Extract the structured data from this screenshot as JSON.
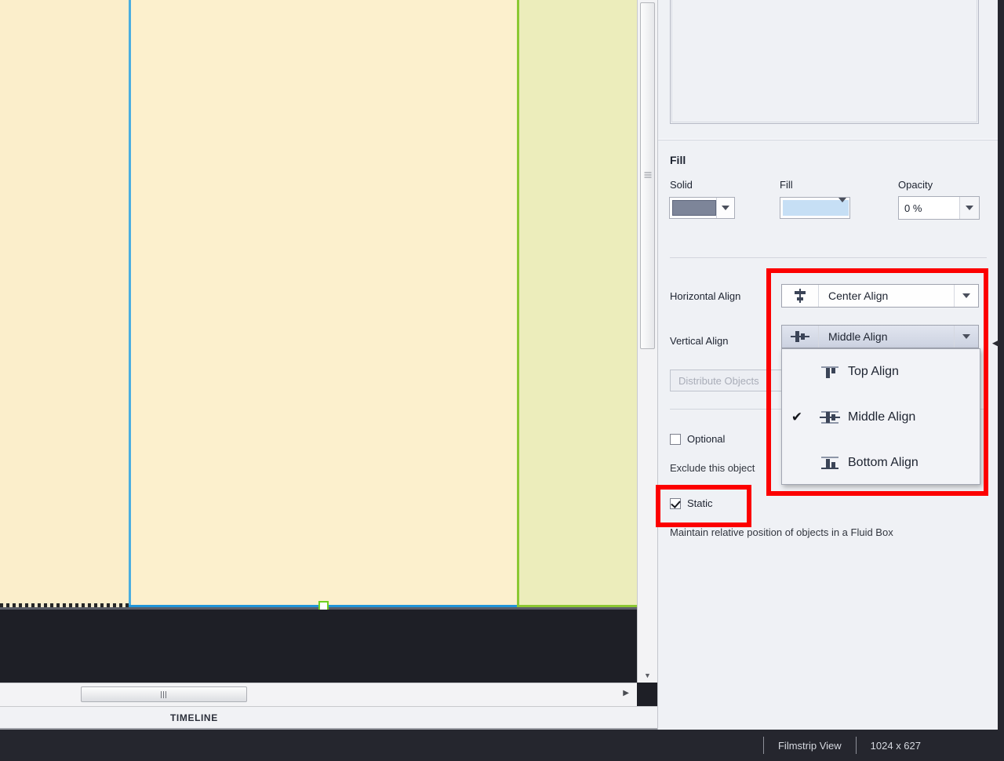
{
  "canvas": {
    "slide_handle_name": "resize-handle",
    "band_colors": [
      "#fbeecb",
      "#fcf0cd",
      "#ecedbb"
    ],
    "divider_blue": "#4aaee0",
    "divider_green": "#8bc832",
    "stage_color": "#5b5e68"
  },
  "timeline": {
    "label": "TIMELINE"
  },
  "properties": {
    "fill_section": {
      "heading": "Fill",
      "solid_label": "Solid",
      "solid_color": "#7d8599",
      "fill_label": "Fill",
      "fill_color": "#c6dff5",
      "opacity_label": "Opacity",
      "opacity_value": "0 %"
    },
    "align_section": {
      "horizontal_label": "Horizontal Align",
      "horizontal_value": "Center Align",
      "vertical_label": "Vertical Align",
      "vertical_value": "Middle Align",
      "distribute_placeholder": "Distribute Objects"
    },
    "options_section": {
      "optional_label": "Optional",
      "optional_checked": false,
      "optional_help": "Exclude this object",
      "static_label": "Static",
      "static_checked": true,
      "static_help": "Maintain relative position of objects in a Fluid Box"
    }
  },
  "vertical_align_menu": {
    "items": [
      {
        "label": "Top Align",
        "checked": false,
        "icon": "top-align-icon"
      },
      {
        "label": "Middle Align",
        "checked": true,
        "icon": "middle-align-icon"
      },
      {
        "label": "Bottom Align",
        "checked": false,
        "icon": "bottom-align-icon"
      }
    ],
    "check_glyph": "✔"
  },
  "annotations": {
    "highlight_color": "#fc0000"
  },
  "status_bar": {
    "view_mode": "Filmstrip View",
    "dimensions": "1024 x 627"
  }
}
